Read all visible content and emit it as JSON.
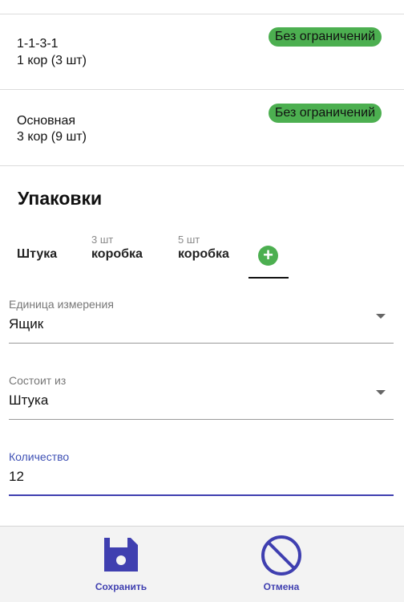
{
  "cards": [
    {
      "line1": "1-1-3-1",
      "line2": "1 кор (3 шт)",
      "badge": "Без ограничений"
    },
    {
      "line1": "Основная",
      "line2": "3 кор (9 шт)",
      "badge": "Без ограничений"
    }
  ],
  "packaging": {
    "title": "Упаковки",
    "tabs": [
      {
        "sub": "",
        "label": "Штука"
      },
      {
        "sub": "3 шт",
        "label": "коробка"
      },
      {
        "sub": "5 шт",
        "label": "коробка"
      }
    ],
    "add_icon": "plus-icon",
    "add_symbol": "+"
  },
  "form": {
    "unit": {
      "label": "Единица измерения",
      "value": "Ящик"
    },
    "consists_of": {
      "label": "Состоит из",
      "value": "Штука"
    },
    "quantity": {
      "label": "Количество",
      "value": "12"
    }
  },
  "actions": {
    "save_label": "Сохранить",
    "save_icon": "floppy-disk-icon",
    "cancel_label": "Отмена",
    "cancel_icon": "cancel-icon"
  },
  "colors": {
    "accent": "#3f3fb0",
    "badge_bg": "#4caf50"
  }
}
